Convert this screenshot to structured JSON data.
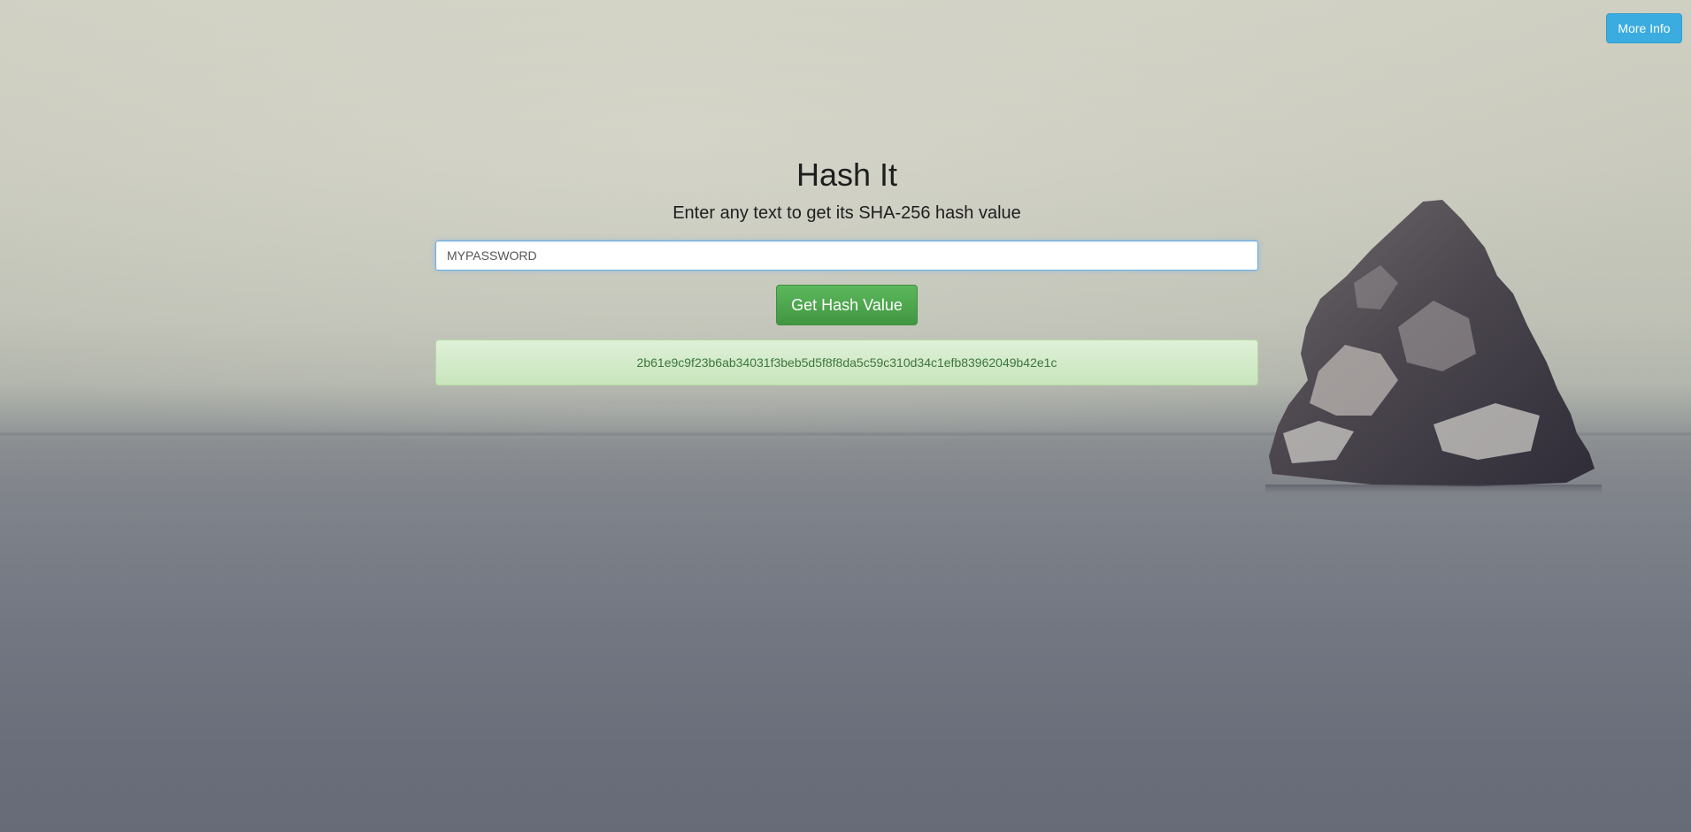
{
  "header": {
    "more_info_label": "More Info"
  },
  "main": {
    "title": "Hash It",
    "subtitle": "Enter any text to get its SHA-256 hash value",
    "input_value": "MYPASSWORD",
    "button_label": "Get Hash Value",
    "result_hash": "2b61e9c9f23b6ab34031f3beb5d5f8f8da5c59c310d34c1efb83962049b42e1c"
  },
  "colors": {
    "info_button": "#3aace0",
    "success_button": "#5cb85c",
    "result_background": "#dff0d8",
    "result_text": "#3c763d"
  }
}
